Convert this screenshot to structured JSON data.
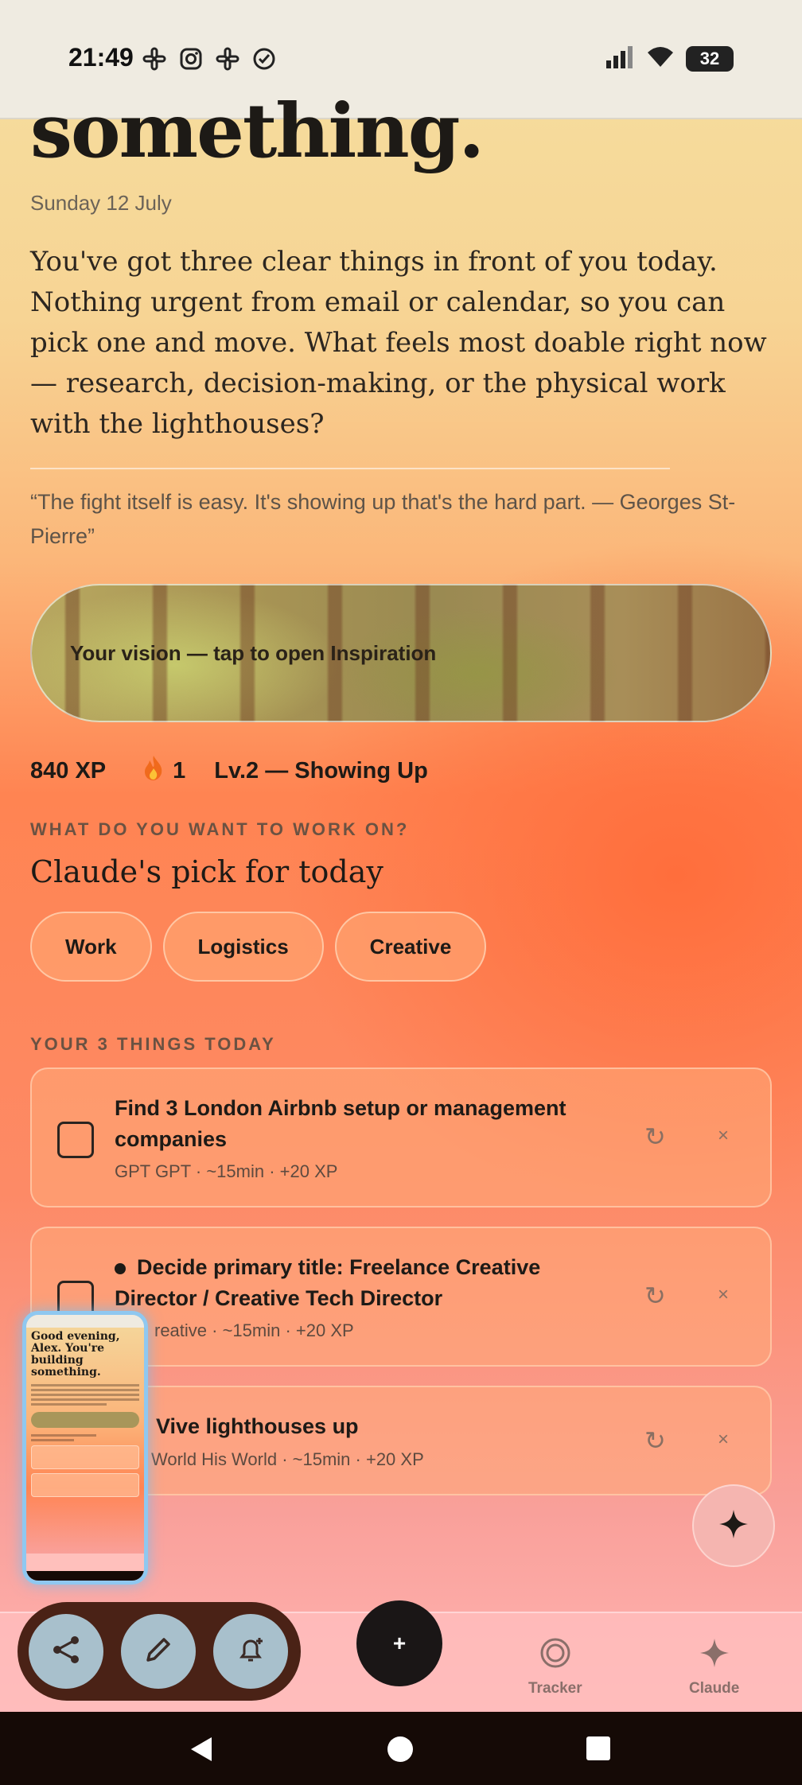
{
  "status_bar": {
    "time": "21:49",
    "battery": "32",
    "left_icons": [
      "slack-icon",
      "instagram-icon",
      "slack-icon",
      "check-circle-icon"
    ],
    "right_icons": [
      "signal-icon",
      "wifi-icon",
      "battery-icon"
    ]
  },
  "header": {
    "greeting": "something.",
    "date": "Sunday 12 July",
    "intro": "You've got three clear things in front of you today. Nothing urgent from email or calendar, so you can pick one and move. What feels most doable right now — research, decision-making, or the physical work with the lighthouses?",
    "quote": "“The fight itself is easy. It's showing up that's the hard part. — Georges St-Pierre”"
  },
  "vision": {
    "label": "Your vision — tap to open Inspiration"
  },
  "stats": {
    "xp": "840 XP",
    "streak": "1",
    "level": "Lv.2 — Showing Up"
  },
  "focus": {
    "label": "WHAT DO YOU WANT TO WORK ON?",
    "title": "Claude's pick for today",
    "chips": [
      "Work",
      "Logistics",
      "Creative"
    ]
  },
  "tasks": {
    "label": "YOUR 3 THINGS TODAY",
    "items": [
      {
        "title": "Find 3 London Airbnb setup or management companies",
        "meta": "GPT GPT · ~15min · +20 XP",
        "refresh": "↻",
        "close": "×"
      },
      {
        "title": "Decide primary title: Freelance Creative Director / Creative Tech Director",
        "meta": "reative · ~15min · +20 XP",
        "refresh": "↻",
        "close": "×"
      },
      {
        "title": "Vive lighthouses up",
        "meta": "World His World · ~15min · +20 XP",
        "refresh": "↻",
        "close": "×"
      }
    ]
  },
  "bottom_nav": {
    "add_label": "+",
    "tracker_label": "Tracker",
    "claude_label": "Claude"
  },
  "screenshot_thumb": {
    "title": "Good evening, Alex. You're building something.",
    "chips": [
      "Work",
      "Logistics",
      "Creative"
    ]
  },
  "colors": {
    "accent_dark": "#1a1616",
    "tray": "#4a2216",
    "tray_button": "#a8c0cc"
  }
}
